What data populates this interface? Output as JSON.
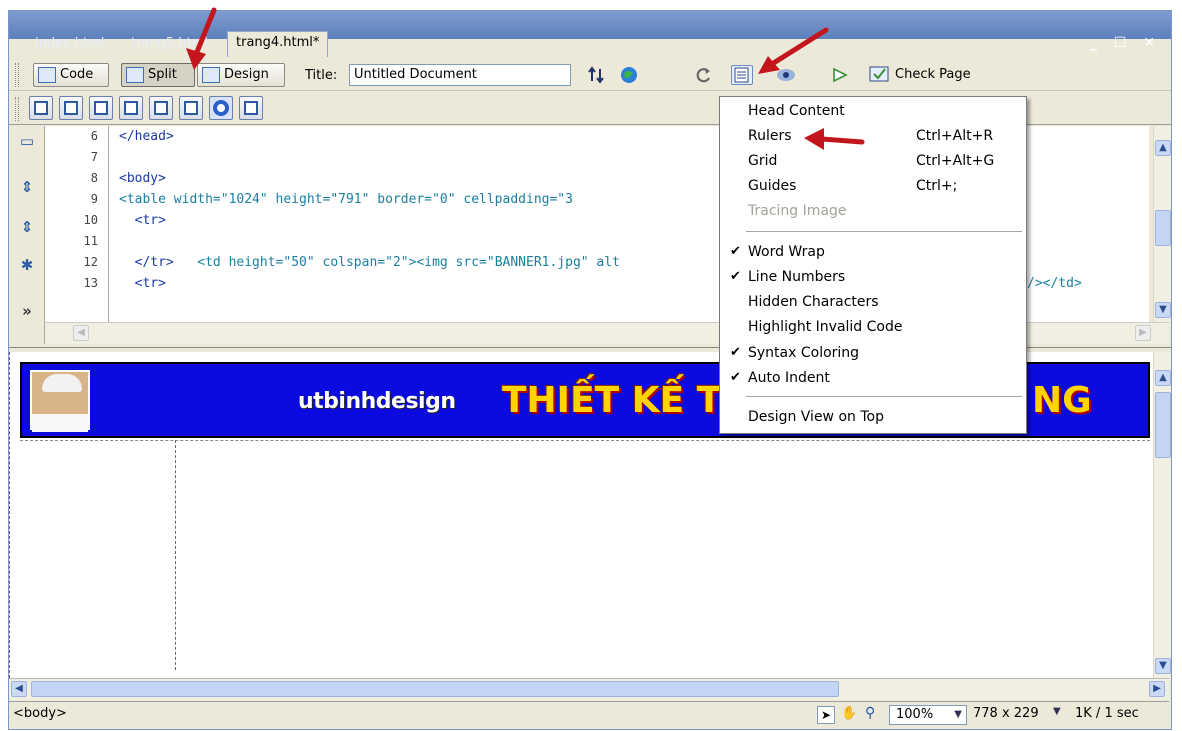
{
  "tabs": [
    "index.html",
    "trang5.html",
    "trang4.html*"
  ],
  "window_controls": "_ ☐ ✕",
  "toolbar": {
    "code_label": "Code",
    "split_label": "Split",
    "design_label": "Design",
    "title_label": "Title:",
    "title_value": "Untitled Document",
    "check_page_label": "Check Page"
  },
  "code_lines": [
    {
      "num": "6",
      "text": "</head>"
    },
    {
      "num": "7",
      "text": ""
    },
    {
      "num": "8",
      "text": "<body>"
    },
    {
      "num": "9",
      "text": "<table width=\"1024\" height=\"791\" border=\"0\" cellpadding=\"3"
    },
    {
      "num": "10",
      "text": "  <tr>"
    },
    {
      "num": "11",
      "text": "    <td height=\"50\" colspan=\"2\"><img src=\"BANNER1.jpg\" alt"
    },
    {
      "num": "12",
      "text": "  </tr>"
    },
    {
      "num": "13",
      "text": "  <tr>"
    }
  ],
  "code_line11_tail": "/></td>",
  "banner": {
    "small_text": "utbinhdesign",
    "big_text": "THIẾT KẾ TR",
    "tail_text": "NG"
  },
  "menu_items": [
    {
      "label": "Head Content",
      "shortcut": "",
      "checked": false,
      "disabled": false
    },
    {
      "label": "Rulers",
      "shortcut": "Ctrl+Alt+R",
      "checked": false,
      "disabled": false
    },
    {
      "label": "Grid",
      "shortcut": "Ctrl+Alt+G",
      "checked": false,
      "disabled": false
    },
    {
      "label": "Guides",
      "shortcut": "Ctrl+;",
      "checked": false,
      "disabled": false
    },
    {
      "label": "Tracing Image",
      "shortcut": "",
      "checked": false,
      "disabled": true
    },
    {
      "label": "Word Wrap",
      "shortcut": "",
      "checked": true,
      "disabled": false
    },
    {
      "label": "Line Numbers",
      "shortcut": "",
      "checked": true,
      "disabled": false
    },
    {
      "label": "Hidden Characters",
      "shortcut": "",
      "checked": false,
      "disabled": false
    },
    {
      "label": "Highlight Invalid Code",
      "shortcut": "",
      "checked": false,
      "disabled": false
    },
    {
      "label": "Syntax Coloring",
      "shortcut": "",
      "checked": true,
      "disabled": false
    },
    {
      "label": "Auto Indent",
      "shortcut": "",
      "checked": true,
      "disabled": false
    },
    {
      "label": "Design View on Top",
      "shortcut": "",
      "checked": false,
      "disabled": false
    }
  ],
  "status": {
    "tag": "<body>",
    "zoom": "100%",
    "dimensions": "778 x 229",
    "size": "1K / 1 sec"
  },
  "colors": {
    "banner_blue": "#0b0be0",
    "banner_yellow": "#ffd400",
    "annotation_red": "#c3161c",
    "code_teal": "#1a7fa0"
  }
}
